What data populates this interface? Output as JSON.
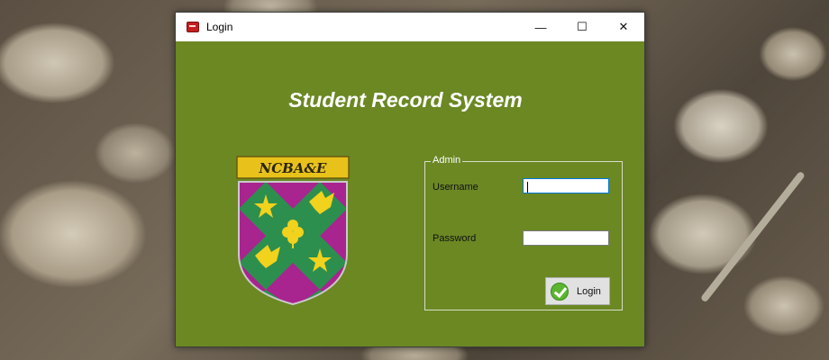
{
  "window": {
    "title": "Login",
    "controls": {
      "minimize": "—",
      "maximize": "☐",
      "close": "✕"
    }
  },
  "main": {
    "heading": "Student Record System",
    "crest": {
      "banner_text": "NCBA&E"
    }
  },
  "login_group": {
    "legend": "Admin",
    "username_label": "Username",
    "username_value": "",
    "password_label": "Password",
    "password_value": "",
    "login_button_label": "Login"
  },
  "colors": {
    "form_background": "#6b8823",
    "heading_text": "#ffffff",
    "crest_gold": "#e8c21a",
    "crest_green": "#2d8f4e",
    "crest_magenta": "#a8248f"
  },
  "icons": [
    "app-icon",
    "minimize-icon",
    "maximize-icon",
    "close-icon",
    "check-icon"
  ]
}
